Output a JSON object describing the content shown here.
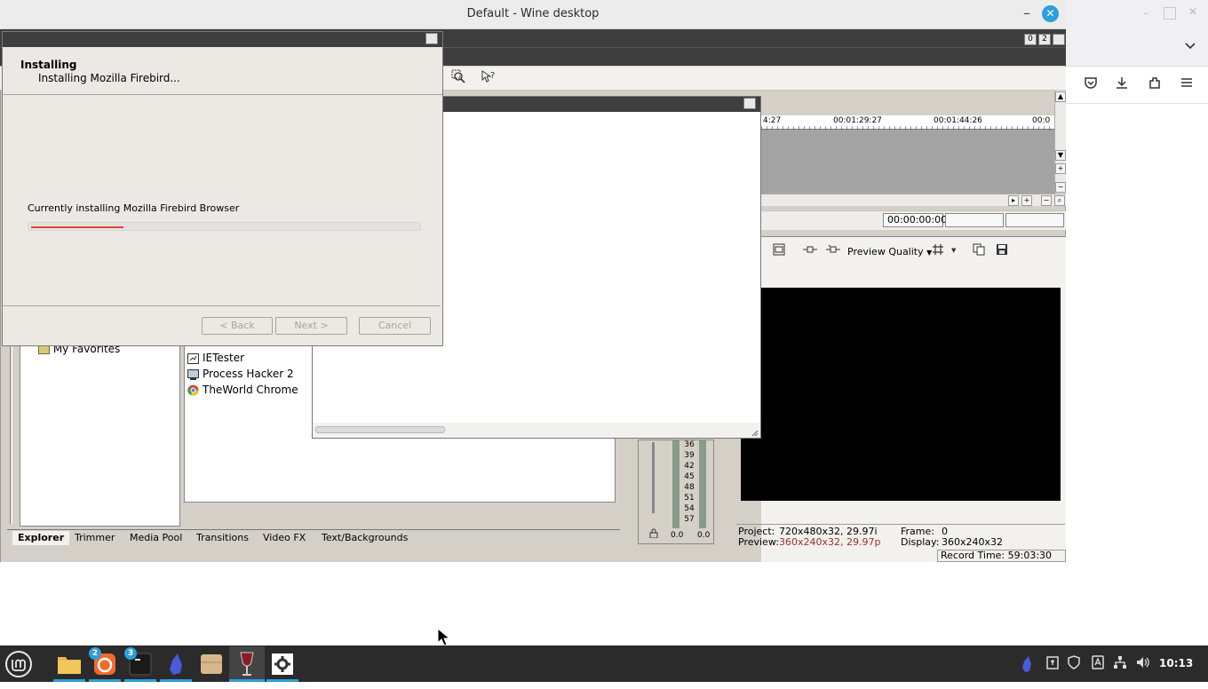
{
  "wine": {
    "title": "Default - Wine desktop",
    "minimize_glyph": "–",
    "close_glyph": "✕"
  },
  "browser": {
    "icons": [
      "chevron-down-icon",
      "pocket-icon",
      "download-icon",
      "extensions-icon",
      "menu-icon"
    ]
  },
  "app": {
    "title_buttons": [
      "0",
      "2",
      ""
    ],
    "timeline_ticks": [
      "4:27",
      "00:01:29:27",
      "00:01:44:26",
      "00:0"
    ],
    "timecode": "00:00:00:00",
    "preview_quality_label": "Preview Quality",
    "preview_info": {
      "project_label": "Project:",
      "project_value": "720x480x32, 29.97i",
      "preview_label": "Preview:",
      "preview_value": "360x240x32, 29.97p",
      "frame_label": "Frame:",
      "frame_value": "0",
      "display_label": "Display:",
      "display_value": "360x240x32"
    },
    "record_time": "Record Time: 59:03:30",
    "meter_scale": [
      "36",
      "39",
      "42",
      "45",
      "48",
      "51",
      "54",
      "57"
    ],
    "meter_values": [
      "0.0",
      "0.0"
    ],
    "tree_item": "My Favorites",
    "files": [
      "IETester",
      "Process Hacker 2",
      "TheWorld Chrome"
    ],
    "tabs": [
      "Explorer",
      "Trimmer",
      "Media Pool",
      "Transitions",
      "Video FX",
      "Text/Backgrounds"
    ]
  },
  "installer": {
    "heading": "Installing",
    "subheading": "Installing Mozilla Firebird...",
    "status": "Currently installing Mozilla Firebird Browser",
    "progress": 0.24,
    "back_label": "< Back",
    "next_label": "Next >",
    "cancel_label": "Cancel"
  },
  "taskbar": {
    "badges": [
      "2",
      "3"
    ],
    "clock": "10:13"
  },
  "colors": {
    "accent": "#2d9fd9",
    "progress": "#e2443a",
    "dark_title": "#3e3e3e",
    "preview_red": "#a0302a"
  }
}
